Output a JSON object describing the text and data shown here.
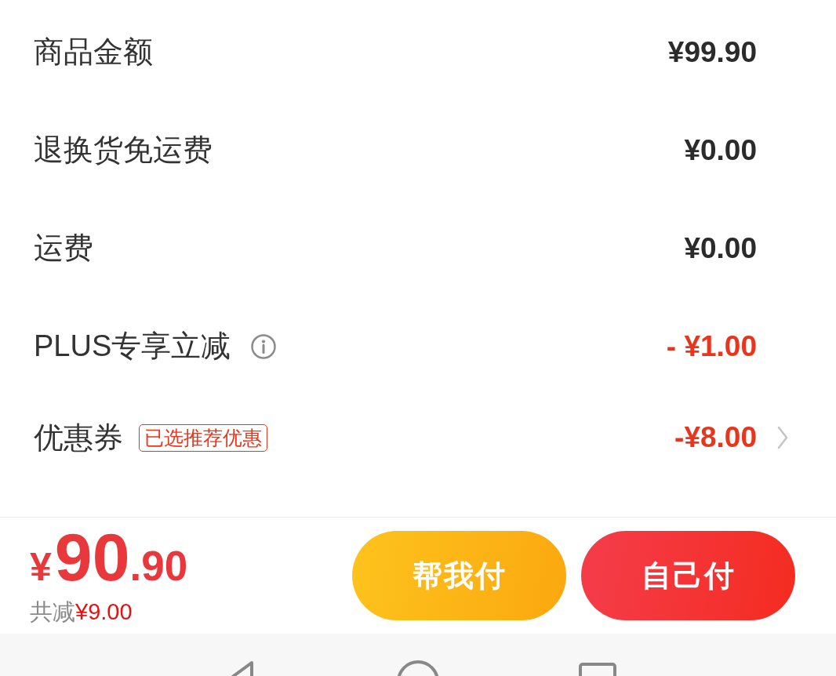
{
  "price_rows": [
    {
      "label": "商品金额",
      "value": "¥99.90",
      "kind": "plain"
    },
    {
      "label": "退换货免运费",
      "value": "¥0.00",
      "kind": "plain"
    },
    {
      "label": "运费",
      "value": "¥0.00",
      "kind": "plain"
    },
    {
      "label": "PLUS专享立减",
      "value": "- ¥1.00",
      "kind": "discount"
    },
    {
      "label": "优惠券",
      "value": "-¥8.00",
      "kind": "coupon",
      "tag": "已选推荐优惠"
    }
  ],
  "footer": {
    "total": {
      "currency": "¥",
      "integer": "90",
      "decimal": ".90"
    },
    "savings": {
      "label": "共减",
      "amount": "¥9.00"
    },
    "buttons": [
      {
        "label": "帮我付",
        "kind": "secondary"
      },
      {
        "label": "自己付",
        "kind": "primary"
      }
    ]
  }
}
